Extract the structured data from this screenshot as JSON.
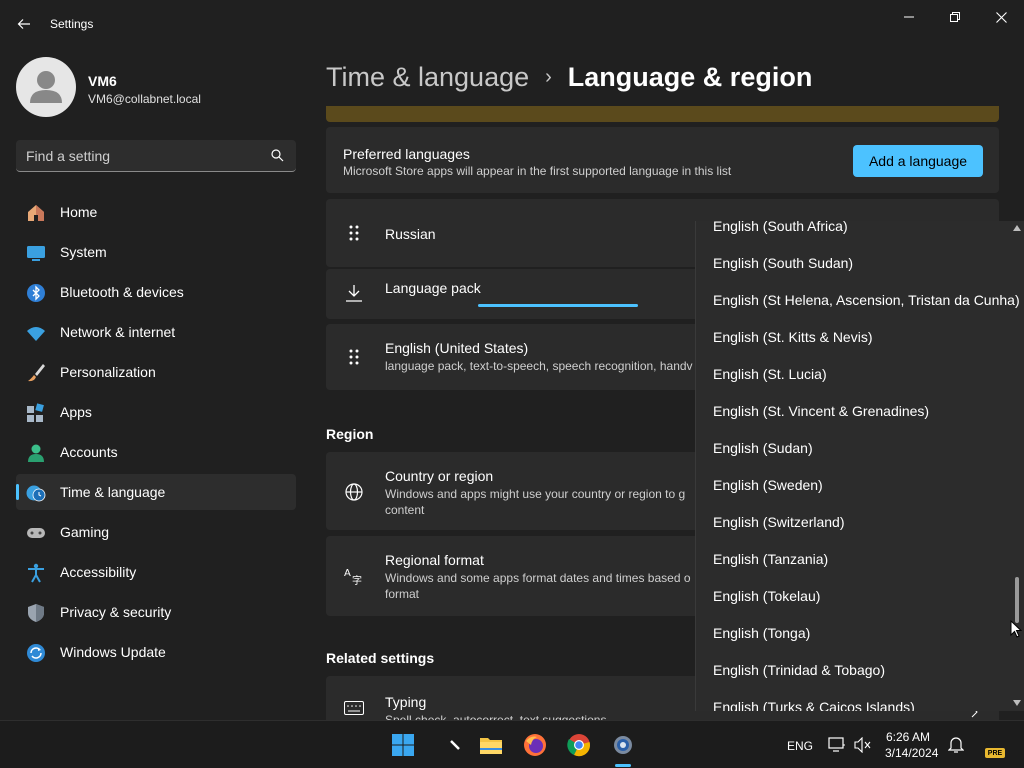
{
  "window": {
    "title": "Settings"
  },
  "profile": {
    "name": "VM6",
    "email": "VM6@collabnet.local"
  },
  "search": {
    "placeholder": "Find a setting"
  },
  "sidebar": {
    "items": [
      {
        "label": "Home",
        "icon": "home-icon"
      },
      {
        "label": "System",
        "icon": "system-icon"
      },
      {
        "label": "Bluetooth & devices",
        "icon": "bluetooth-icon"
      },
      {
        "label": "Network & internet",
        "icon": "wifi-icon"
      },
      {
        "label": "Personalization",
        "icon": "brush-icon"
      },
      {
        "label": "Apps",
        "icon": "apps-icon"
      },
      {
        "label": "Accounts",
        "icon": "accounts-icon"
      },
      {
        "label": "Time & language",
        "icon": "time-language-icon",
        "active": true
      },
      {
        "label": "Gaming",
        "icon": "gamepad-icon"
      },
      {
        "label": "Accessibility",
        "icon": "accessibility-icon"
      },
      {
        "label": "Privacy & security",
        "icon": "shield-icon"
      },
      {
        "label": "Windows Update",
        "icon": "update-icon"
      }
    ]
  },
  "header": {
    "parent": "Time & language",
    "separator": "›",
    "current": "Language & region"
  },
  "preferred": {
    "title": "Preferred languages",
    "subtitle": "Microsoft Store apps will appear in the first supported language in this list",
    "button": "Add a language"
  },
  "languages": {
    "russian": "Russian",
    "pack": "Language pack",
    "english_title": "English (United States)",
    "english_sub": "language pack, text-to-speech, speech recognition, handv"
  },
  "region": {
    "heading": "Region",
    "country_title": "Country or region",
    "country_sub_1": "Windows and apps might use your country or region to g",
    "country_sub_2": "content",
    "format_title": "Regional format",
    "format_sub_1": "Windows and some apps format dates and times based o",
    "format_sub_2": "format"
  },
  "related": {
    "heading": "Related settings",
    "typing_title": "Typing",
    "typing_sub": "Spell check, autocorrect, text suggestions"
  },
  "dropdown": {
    "items": [
      "English (South Africa)",
      "English (South Sudan)",
      "English (St Helena, Ascension, Tristan da Cunha)",
      "English (St. Kitts & Nevis)",
      "English (St. Lucia)",
      "English (St. Vincent & Grenadines)",
      "English (Sudan)",
      "English (Sweden)",
      "English (Switzerland)",
      "English (Tanzania)",
      "English (Tokelau)",
      "English (Tonga)",
      "English (Trinidad & Tobago)",
      "English (Turks & Caicos Islands)"
    ]
  },
  "taskbar": {
    "lang": "ENG",
    "time": "6:26 AM",
    "date": "3/14/2024",
    "badge": "PRE"
  },
  "colors": {
    "accent": "#4cc2ff",
    "background": "#202020",
    "card": "#2b2b2b"
  }
}
